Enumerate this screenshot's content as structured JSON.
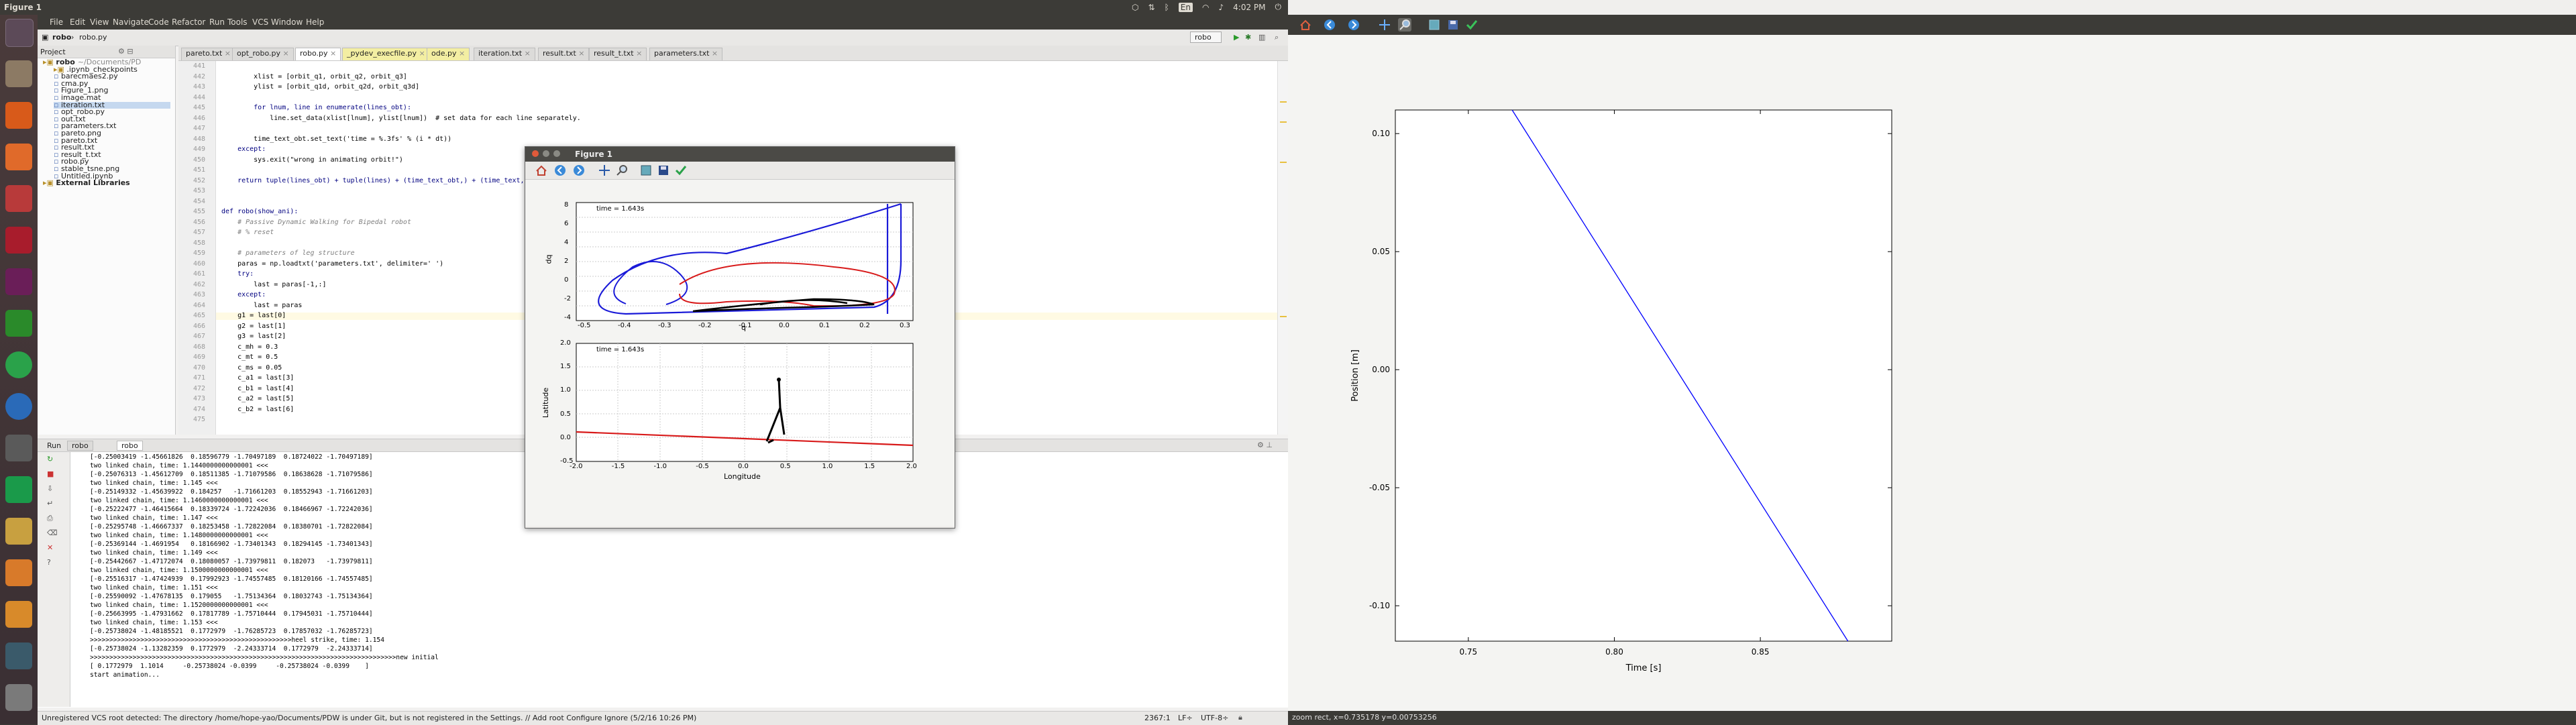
{
  "system": {
    "active_window_title": "Figure 1",
    "clock": "4:02 PM",
    "keyboard_layout": "En"
  },
  "launcher": {
    "icons": [
      "dash-icon",
      "files-icon",
      "browser-icon",
      "ubuntu-software-icon",
      "settings-icon",
      "mendeley-icon",
      "terminal-icon",
      "vim-icon",
      "chrome-icon",
      "thunderbird-icon",
      "inkscape-icon",
      "pycharm-icon",
      "document-viewer-icon",
      "matlab-icon",
      "oscilloscope-icon",
      "system-monitor-icon",
      "camera-icon",
      "terminal2-icon",
      "trash-icon"
    ]
  },
  "ide": {
    "menu": [
      "File",
      "Edit",
      "View",
      "Navigate",
      "Code",
      "Refactor",
      "Run",
      "Tools",
      "VCS",
      "Window",
      "Help"
    ],
    "breadcrumb": [
      "robo",
      "robo.py"
    ],
    "run_config": "robo",
    "project_panel_title": "Project",
    "project_tree": [
      {
        "label": "robo",
        "path": "~/Documents/PD",
        "type": "folder",
        "indent": 0
      },
      {
        "label": ".ipynb_checkpoints",
        "type": "folder",
        "indent": 1
      },
      {
        "label": "barecmaes2.py",
        "type": "file",
        "indent": 1
      },
      {
        "label": "cma.py",
        "type": "file",
        "indent": 1
      },
      {
        "label": "Figure_1.png",
        "type": "file",
        "indent": 1
      },
      {
        "label": "image.mat",
        "type": "file",
        "indent": 1
      },
      {
        "label": "iteration.txt",
        "type": "file",
        "indent": 1,
        "selected": true
      },
      {
        "label": "opt_robo.py",
        "type": "file",
        "indent": 1
      },
      {
        "label": "out.txt",
        "type": "file",
        "indent": 1
      },
      {
        "label": "parameters.txt",
        "type": "file",
        "indent": 1
      },
      {
        "label": "pareto.png",
        "type": "file",
        "indent": 1
      },
      {
        "label": "pareto.txt",
        "type": "file",
        "indent": 1
      },
      {
        "label": "result.txt",
        "type": "file",
        "indent": 1
      },
      {
        "label": "result_t.txt",
        "type": "file",
        "indent": 1
      },
      {
        "label": "robo.py",
        "type": "file",
        "indent": 1
      },
      {
        "label": "stable_tsne.png",
        "type": "file",
        "indent": 1
      },
      {
        "label": "Untitled.ipynb",
        "type": "file",
        "indent": 1
      },
      {
        "label": "External Libraries",
        "type": "folder",
        "indent": 0
      }
    ],
    "tabs": [
      {
        "label": "pareto.txt",
        "active": false,
        "yellow": false
      },
      {
        "label": "opt_robo.py",
        "active": false,
        "yellow": false
      },
      {
        "label": "robo.py",
        "active": true,
        "yellow": false
      },
      {
        "label": "_pydev_execfile.py",
        "active": false,
        "yellow": true
      },
      {
        "label": "ode.py",
        "active": false,
        "yellow": true
      },
      {
        "label": "iteration.txt",
        "active": false,
        "yellow": false
      },
      {
        "label": "result.txt",
        "active": false,
        "yellow": false
      },
      {
        "label": "result_t.txt",
        "active": false,
        "yellow": false
      },
      {
        "label": "parameters.txt",
        "active": false,
        "yellow": false
      }
    ],
    "line_numbers": [
      "441",
      "442",
      "443",
      "444",
      "445",
      "446",
      "447",
      "448",
      "449",
      "450",
      "451",
      "452",
      "453",
      "454",
      "455",
      "456",
      "457",
      "458",
      "459",
      "460",
      "461",
      "462",
      "463",
      "464",
      "465",
      "466",
      "467",
      "468",
      "469",
      "470",
      "471",
      "472",
      "473",
      "474",
      "475"
    ],
    "code_lines": [
      "",
      "        xlist = [orbit_q1, orbit_q2, orbit_q3]",
      "        ylist = [orbit_q1d, orbit_q2d, orbit_q3d]",
      "",
      "        for lnum, line in enumerate(lines_obt):",
      "            line.set_data(xlist[lnum], ylist[lnum])  # set data for each line separately.",
      "",
      "        time_text_obt.set_text('time = %.3fs' % (i * dt))",
      "    except:",
      "        sys.exit(\"wrong in animating orbit!\")",
      "",
      "    return tuple(lines_obt) + tuple(lines) + (time_text_obt,) + (time_text,)",
      "",
      "",
      "def robo(show_ani):",
      "    # Passive Dynamic Walking for Bipedal robot",
      "    # % reset",
      "",
      "    # parameters of leg structure",
      "    paras = np.loadtxt('parameters.txt', delimiter=' ')",
      "    try:",
      "        last = paras[-1,:]",
      "    except:",
      "        last = paras",
      "    g1 = last[0]",
      "    g2 = last[1]",
      "    g3 = last[2]",
      "    c_mh = 0.3",
      "    c_mt = 0.5",
      "    c_ms = 0.05",
      "    c_a1 = last[3]",
      "    c_b1 = last[4]",
      "    c_a2 = last[5]",
      "    c_b2 = last[6]",
      ""
    ],
    "run_tab_label": "Run",
    "run_tabs": [
      "robo",
      "robo"
    ],
    "console_lines": [
      "[-0.25003419 -1.45661826  0.18596779 -1.70497189  0.18724022 -1.70497189]",
      "two linked chain, time: 1.1440000000000001 <<<",
      "[-0.25076313 -1.45612709  0.18511385 -1.71079586  0.18638628 -1.71079586]",
      "two linked chain, time: 1.145 <<<",
      "[-0.25149332 -1.45639922  0.184257   -1.71661203  0.18552943 -1.71661203]",
      "two linked chain, time: 1.1460000000000001 <<<",
      "[-0.25222477 -1.46415664  0.18339724 -1.72242036  0.18466967 -1.72242036]",
      "two linked chain, time: 1.147 <<<",
      "[-0.25295748 -1.46667337  0.18253458 -1.72822084  0.18380701 -1.72822084]",
      "two linked chain, time: 1.1480000000000001 <<<",
      "[-0.25369144 -1.4691954   0.18166902 -1.73401343  0.18294145 -1.73401343]",
      "two linked chain, time: 1.149 <<<",
      "[-0.25442667 -1.47172074  0.18080057 -1.73979811  0.182073   -1.73979811]",
      "two linked chain, time: 1.1500000000000001 <<<",
      "[-0.25516317 -1.47424939  0.17992923 -1.74557485  0.18120166 -1.74557485]",
      "two linked chain, time: 1.151 <<<",
      "[-0.25590092 -1.47678135  0.179055   -1.75134364  0.18032743 -1.75134364]",
      "two linked chain, time: 1.1520000000000001 <<<",
      "[-0.25663995 -1.47931662  0.17817789 -1.75710444  0.17945031 -1.75710444]",
      "two linked chain, time: 1.153 <<<",
      "[-0.25738024 -1.48185521  0.1772979  -1.76285723  0.17857032 -1.76285723]",
      ">>>>>>>>>>>>>>>>>>>>>>>>>>>>>>>>>>>>>>>>>>>>>>>>>>>>heel strike, time: 1.154",
      "[-0.25738024 -1.13282359  0.1772979  -2.24333714  0.1772979  -2.24333714]",
      ">>>>>>>>>>>>>>>>>>>>>>>>>>>>>>>>>>>>>>>>>>>>>>>>>>>>>>>>>>>>>>>>>>>>>>>>>>>>>>>new initial",
      "[ 0.1772979  1.1014     -0.25738024 -0.0399     -0.25738024 -0.0399    ]",
      "start animation..."
    ],
    "status_left": "Unregistered VCS root detected: The directory /home/hope-yao/Documents/PDW is under Git, but is not registered in the Settings. // Add root  Configure  Ignore (5/2/16 10:26 PM)",
    "status_right": [
      "2367:1",
      "LF÷",
      "UTF-8÷"
    ]
  },
  "figure_small": {
    "title": "Figure 1",
    "top_plot": {
      "time_text": "time = 1.643s",
      "ylabel": "dq",
      "xlabel": "q",
      "xticks": [
        "-0.5",
        "-0.4",
        "-0.3",
        "-0.2",
        "-0.1",
        "0.0",
        "0.1",
        "0.2",
        "0.3"
      ],
      "yticks": [
        "8",
        "6",
        "4",
        "2",
        "0",
        "-2",
        "-4"
      ]
    },
    "bottom_plot": {
      "time_text": "time = 1.643s",
      "ylabel": "Latitude",
      "xlabel": "Longitude",
      "xticks": [
        "-2.0",
        "-1.5",
        "-1.0",
        "-0.5",
        "0.0",
        "0.5",
        "1.0",
        "1.5",
        "2.0"
      ],
      "yticks": [
        "2.0",
        "1.5",
        "1.0",
        "0.5",
        "0.0",
        "-0.5"
      ]
    }
  },
  "figure_big": {
    "title": "Figure 1",
    "status": "zoom rect, x=0.735178     y=0.00753256",
    "chart_data": {
      "type": "line",
      "xlabel": "Time [s]",
      "ylabel": "Position [m]",
      "xlim": [
        0.725,
        0.895
      ],
      "ylim": [
        -0.115,
        0.11
      ],
      "xticks": [
        "0.75",
        "0.80",
        "0.85"
      ],
      "yticks": [
        "0.10",
        "0.05",
        "0.00",
        "-0.05",
        "-0.10"
      ],
      "series": [
        {
          "color": "#0000ff",
          "x": [
            0.765,
            0.88
          ],
          "y": [
            0.11,
            -0.115
          ]
        }
      ]
    }
  }
}
